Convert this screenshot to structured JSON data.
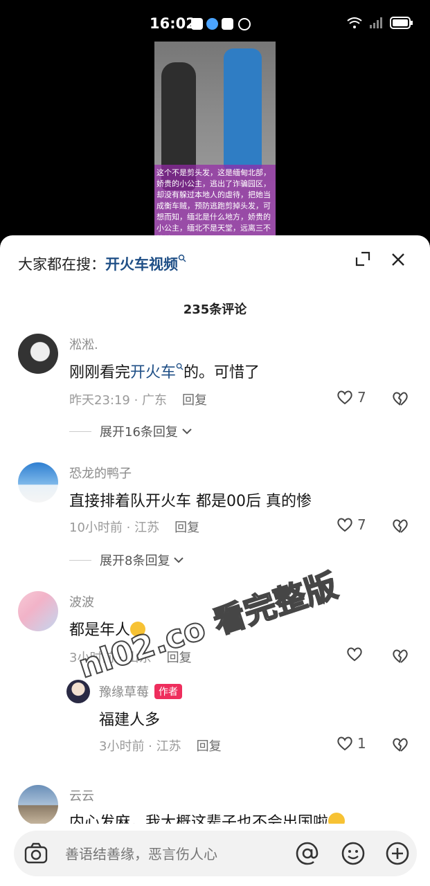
{
  "status": {
    "time": "16:02"
  },
  "video": {
    "caption": "这个不是剪头发，这是缅甸北部，娇贵的小公主，逃出了诈骗园区，却没有躲过本地人的虐待，把她当成衡车贼，预防逃跑剪掉头发，可想而知，缅北是什么地方，娇贵的小公主，缅北不是天堂，远离三不管地带"
  },
  "panel": {
    "search_prefix": "大家都在搜：",
    "search_keyword": "开火车视频",
    "comment_count": "235条评论"
  },
  "comments": [
    {
      "user": "淞淞.",
      "text_before": "刚刚看完",
      "text_link": "开火车",
      "text_after": "的。可惜了",
      "time_loc": "昨天23:19 · 广东",
      "reply": "回复",
      "likes": "7",
      "expand": "展开16条回复"
    },
    {
      "user": "恐龙的鸭子",
      "text": "直接排着队开火车  都是00后  真的惨",
      "time_loc": "10小时前 · 江苏",
      "reply": "回复",
      "likes": "7",
      "expand": "展开8条回复"
    },
    {
      "user": "波波",
      "text": "都是年人",
      "time_loc": "3小时前 · 山东",
      "reply": "回复",
      "likes": ""
    },
    {
      "user": "云云",
      "text": "内心发麻，我大概这辈子也不会出国啦"
    }
  ],
  "reply": {
    "user": "豫缘草莓",
    "badge": "作者",
    "text": "福建人多",
    "time_loc": "3小时前 · 江苏",
    "reply": "回复",
    "likes": "1"
  },
  "input": {
    "placeholder": "善语结善缘，恶言伤人心"
  },
  "watermark": "nl02.co 看完整版"
}
